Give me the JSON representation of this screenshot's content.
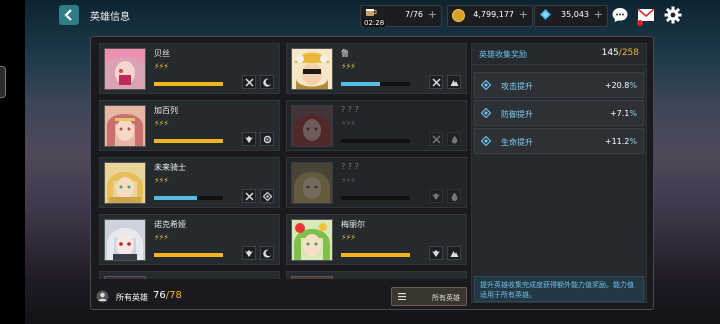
{
  "header": {
    "title": "英雄信息",
    "back_icon": "chevron-left-icon"
  },
  "resources": {
    "stamina": {
      "value": "7/76",
      "timer": "02:28",
      "icon": "coffee-cup-icon"
    },
    "gold": {
      "value": "4,799,177",
      "icon": "gold-coin-icon"
    },
    "gems": {
      "value": "35,043",
      "icon": "blue-gem-icon"
    },
    "plus": "+"
  },
  "top_icons": [
    "chat-icon",
    "mail-icon",
    "settings-gear-icon"
  ],
  "heroes": [
    {
      "name": "贝丝",
      "stars": "⚡⚡⚡",
      "bar": 100,
      "bar_color": "gold",
      "locked": false,
      "classes": [
        "crossed-swords-icon",
        "moon-icon"
      ]
    },
    {
      "name": "鲁",
      "stars": "⚡⚡⚡",
      "bar": 57,
      "bar_color": "blue",
      "locked": false,
      "classes": [
        "crossed-swords-icon",
        "mountain-icon"
      ]
    },
    {
      "name": "加百列",
      "stars": "⚡⚡⚡",
      "bar": 100,
      "bar_color": "gold",
      "locked": false,
      "classes": [
        "wings-icon",
        "gear-icon"
      ]
    },
    {
      "name": "? ? ?",
      "stars": "⚡⚡⚡",
      "bar": 0,
      "bar_color": "gold",
      "locked": true,
      "classes": [
        "crossed-swords-icon",
        "flame-icon"
      ]
    },
    {
      "name": "未来骑士",
      "stars": "⚡⚡⚡",
      "bar": 62,
      "bar_color": "blue",
      "locked": false,
      "classes": [
        "crossed-swords-icon",
        "diamond-icon"
      ]
    },
    {
      "name": "? ? ?",
      "stars": "⚡⚡⚡",
      "bar": 0,
      "bar_color": "gold",
      "locked": true,
      "classes": [
        "wings-icon",
        "droplet-icon"
      ]
    },
    {
      "name": "诺克希娅",
      "stars": "⚡⚡⚡",
      "bar": 100,
      "bar_color": "gold",
      "locked": false,
      "classes": [
        "wings-icon",
        "moon-icon"
      ]
    },
    {
      "name": "梅丽尔",
      "stars": "⚡⚡⚡",
      "bar": 100,
      "bar_color": "gold",
      "locked": false,
      "classes": [
        "wings-icon",
        "mountain-icon"
      ]
    }
  ],
  "collection": {
    "title": "英雄收集奖励",
    "count": "145",
    "total": "/258",
    "stats": [
      {
        "label": "攻击提升",
        "value": "+20.8",
        "unit": "%",
        "icon": "diamond-outline-icon"
      },
      {
        "label": "防御提升",
        "value": "+7.1",
        "unit": "%",
        "icon": "diamond-outline-icon"
      },
      {
        "label": "生命提升",
        "value": "+11.2",
        "unit": "%",
        "icon": "diamond-outline-icon"
      }
    ],
    "description": "提升英雄收集完成度获得额外能力值奖励。能力值适用于所有英雄。"
  },
  "footer": {
    "label": "所有英雄",
    "count": "76",
    "total": "/78",
    "filter_label": "所有英雄",
    "filter_icon": "list-icon",
    "hero_icon": "hero-emblem-icon"
  }
}
